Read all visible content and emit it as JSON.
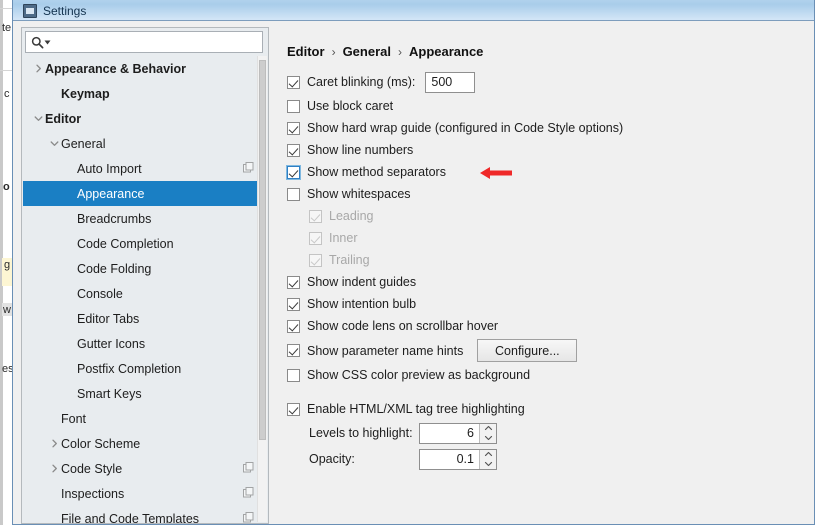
{
  "window": {
    "title": "Settings",
    "title_icon": "settings-window-icon"
  },
  "colors": {
    "selection_blue": "#1a7fc4",
    "titlebar_blue": "#a9cdea",
    "annotation_red": "#ef2929",
    "dialog_bg": "#f0f0f0",
    "sidebar_bg": "#e8ecef"
  },
  "search": {
    "placeholder": "",
    "value": "",
    "icon": "search-icon",
    "dropdown_icon": "chevron-down-icon"
  },
  "sidebar": {
    "items": [
      {
        "label": "Appearance & Behavior",
        "indent": 0,
        "twisty": "collapsed",
        "bold": true,
        "selected": false,
        "badge": false
      },
      {
        "label": "Keymap",
        "indent": 1,
        "twisty": "none",
        "bold": true,
        "selected": false,
        "badge": false
      },
      {
        "label": "Editor",
        "indent": 0,
        "twisty": "expanded",
        "bold": true,
        "selected": false,
        "badge": false
      },
      {
        "label": "General",
        "indent": 1,
        "twisty": "expanded",
        "bold": false,
        "selected": false,
        "badge": false
      },
      {
        "label": "Auto Import",
        "indent": 2,
        "twisty": "none",
        "bold": false,
        "selected": false,
        "badge": true
      },
      {
        "label": "Appearance",
        "indent": 2,
        "twisty": "none",
        "bold": false,
        "selected": true,
        "badge": false
      },
      {
        "label": "Breadcrumbs",
        "indent": 2,
        "twisty": "none",
        "bold": false,
        "selected": false,
        "badge": false
      },
      {
        "label": "Code Completion",
        "indent": 2,
        "twisty": "none",
        "bold": false,
        "selected": false,
        "badge": false
      },
      {
        "label": "Code Folding",
        "indent": 2,
        "twisty": "none",
        "bold": false,
        "selected": false,
        "badge": false
      },
      {
        "label": "Console",
        "indent": 2,
        "twisty": "none",
        "bold": false,
        "selected": false,
        "badge": false
      },
      {
        "label": "Editor Tabs",
        "indent": 2,
        "twisty": "none",
        "bold": false,
        "selected": false,
        "badge": false
      },
      {
        "label": "Gutter Icons",
        "indent": 2,
        "twisty": "none",
        "bold": false,
        "selected": false,
        "badge": false
      },
      {
        "label": "Postfix Completion",
        "indent": 2,
        "twisty": "none",
        "bold": false,
        "selected": false,
        "badge": false
      },
      {
        "label": "Smart Keys",
        "indent": 2,
        "twisty": "none",
        "bold": false,
        "selected": false,
        "badge": false
      },
      {
        "label": "Font",
        "indent": 1,
        "twisty": "none",
        "bold": false,
        "selected": false,
        "badge": false
      },
      {
        "label": "Color Scheme",
        "indent": 1,
        "twisty": "collapsed",
        "bold": false,
        "selected": false,
        "badge": false
      },
      {
        "label": "Code Style",
        "indent": 1,
        "twisty": "collapsed",
        "bold": false,
        "selected": false,
        "badge": true
      },
      {
        "label": "Inspections",
        "indent": 1,
        "twisty": "none",
        "bold": false,
        "selected": false,
        "badge": true
      },
      {
        "label": "File and Code Templates",
        "indent": 1,
        "twisty": "none",
        "bold": false,
        "selected": false,
        "badge": true
      }
    ]
  },
  "content": {
    "breadcrumb": [
      "Editor",
      "General",
      "Appearance"
    ],
    "breadcrumb_separator": "›",
    "options": [
      {
        "label": "Caret blinking (ms):",
        "checked": true,
        "enabled": true,
        "indented": false,
        "focused": false,
        "field": {
          "value": "500"
        }
      },
      {
        "label": "Use block caret",
        "checked": false,
        "enabled": true,
        "indented": false,
        "focused": false
      },
      {
        "label": "Show hard wrap guide (configured in Code Style options)",
        "checked": true,
        "enabled": true,
        "indented": false,
        "focused": false
      },
      {
        "label": "Show line numbers",
        "checked": true,
        "enabled": true,
        "indented": false,
        "focused": false
      },
      {
        "label": "Show method separators",
        "checked": true,
        "enabled": true,
        "indented": false,
        "focused": true,
        "annotation": "red-arrow-pointing-left"
      },
      {
        "label": "Show whitespaces",
        "checked": false,
        "enabled": true,
        "indented": false,
        "focused": false
      },
      {
        "label": "Leading",
        "checked": true,
        "enabled": false,
        "indented": true,
        "focused": false
      },
      {
        "label": "Inner",
        "checked": true,
        "enabled": false,
        "indented": true,
        "focused": false
      },
      {
        "label": "Trailing",
        "checked": true,
        "enabled": false,
        "indented": true,
        "focused": false
      },
      {
        "label": "Show indent guides",
        "checked": true,
        "enabled": true,
        "indented": false,
        "focused": false
      },
      {
        "label": "Show intention bulb",
        "checked": true,
        "enabled": true,
        "indented": false,
        "focused": false
      },
      {
        "label": "Show code lens on scrollbar hover",
        "checked": true,
        "enabled": true,
        "indented": false,
        "focused": false
      },
      {
        "label": "Show parameter name hints",
        "checked": true,
        "enabled": true,
        "indented": false,
        "focused": false,
        "button": "Configure..."
      },
      {
        "label": "Show CSS color preview as background",
        "checked": false,
        "enabled": true,
        "indented": false,
        "focused": false
      }
    ],
    "tag_tree": {
      "enable_label": "Enable HTML/XML tag tree highlighting",
      "enable_checked": true,
      "levels_label": "Levels to highlight:",
      "levels_value": "6",
      "opacity_label": "Opacity:",
      "opacity_value": "0.1"
    }
  },
  "background_editor": {
    "fragments": [
      "te",
      "c",
      "o",
      "g",
      "w",
      "es"
    ]
  }
}
